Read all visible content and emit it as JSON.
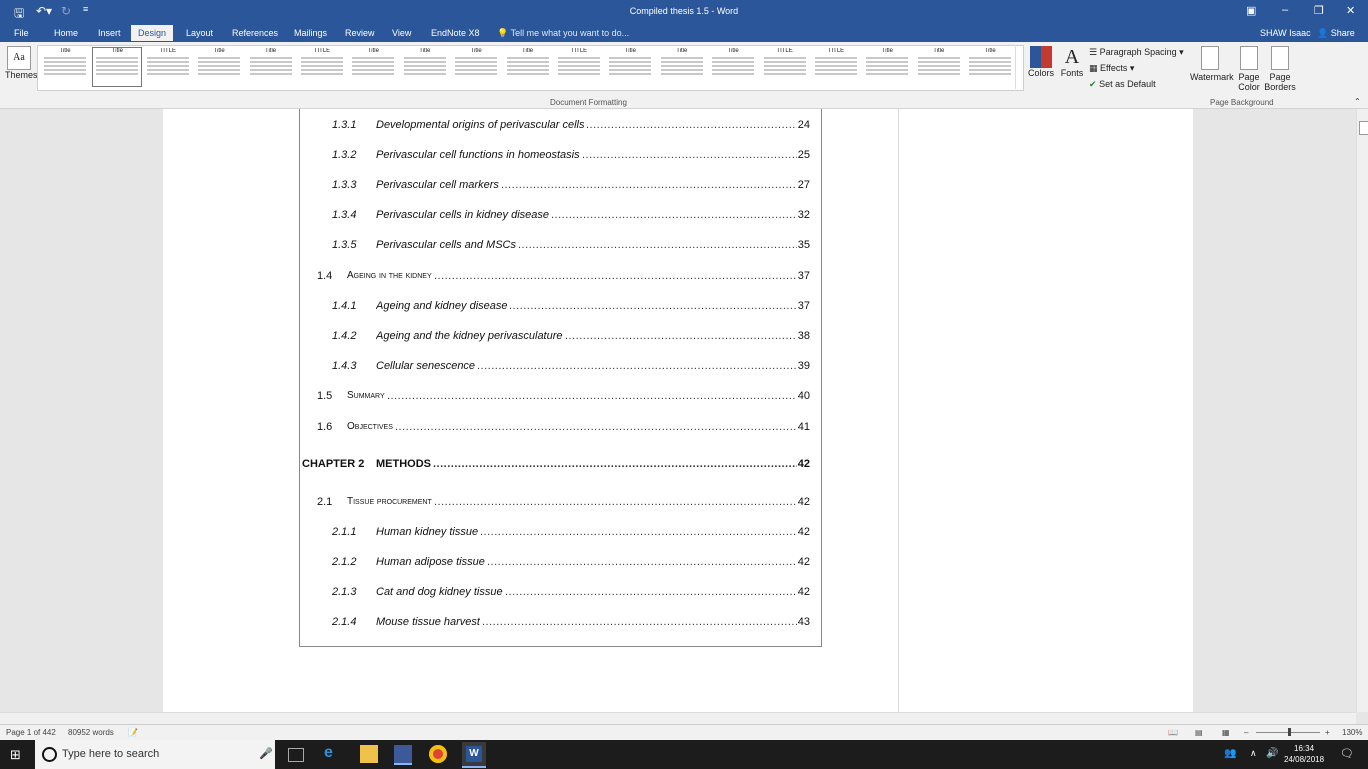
{
  "window": {
    "title": "Compiled thesis 1.5 - Word",
    "user": "SHAW Isaac",
    "share": "Share"
  },
  "tabs": [
    "File",
    "Home",
    "Insert",
    "Design",
    "Layout",
    "References",
    "Mailings",
    "Review",
    "View",
    "EndNote X8"
  ],
  "active_tab": "Design",
  "tell_me": "Tell me what you want to do...",
  "ribbon": {
    "themes": "Themes",
    "colors": "Colors",
    "fonts": "Fonts",
    "paragraph_spacing": "Paragraph Spacing",
    "effects": "Effects",
    "set_default": "Set as Default",
    "watermark": "Watermark",
    "page_color_1": "Page",
    "page_color_2": "Color",
    "page_borders_1": "Page",
    "page_borders_2": "Borders",
    "group_document_formatting": "Document Formatting",
    "group_page_background": "Page Background",
    "style_thumbs": [
      "Title",
      "Title",
      "TITLE",
      "Title",
      "Title",
      "TITLE",
      "Title",
      "Title",
      "Title",
      "Title",
      "TITLE",
      "Title",
      "Title",
      "Title",
      "TITLE",
      "TITLE",
      "Title",
      "Title",
      "Title"
    ]
  },
  "toc": [
    {
      "level": "sub",
      "num": "1.3.1",
      "title": "Developmental origins of perivascular cells",
      "page": "24"
    },
    {
      "level": "sub",
      "num": "1.3.2",
      "title": "Perivascular cell functions in homeostasis",
      "page": "25"
    },
    {
      "level": "sub",
      "num": "1.3.3",
      "title": "Perivascular cell markers",
      "page": "27"
    },
    {
      "level": "sub",
      "num": "1.3.4",
      "title": "Perivascular cells in kidney disease",
      "page": "32"
    },
    {
      "level": "sub",
      "num": "1.3.5",
      "title": "Perivascular cells and MSCs",
      "page": "35"
    },
    {
      "level": "sec",
      "num": "1.4",
      "title": "Ageing in the kidney",
      "page": "37"
    },
    {
      "level": "sub",
      "num": "1.4.1",
      "title": "Ageing and kidney disease",
      "page": "37"
    },
    {
      "level": "sub",
      "num": "1.4.2",
      "title": "Ageing and the kidney perivasculature",
      "page": "38"
    },
    {
      "level": "sub",
      "num": "1.4.3",
      "title": "Cellular senescence",
      "page": "39"
    },
    {
      "level": "sec",
      "num": "1.5",
      "title": "Summary",
      "page": "40"
    },
    {
      "level": "sec",
      "num": "1.6",
      "title": "Objectives",
      "page": "41"
    },
    {
      "level": "ch",
      "num": "CHAPTER 2",
      "title": "METHODS",
      "page": "42"
    },
    {
      "level": "sec",
      "num": "2.1",
      "title": "Tissue procurement",
      "page": "42"
    },
    {
      "level": "sub",
      "num": "2.1.1",
      "title": "Human kidney tissue",
      "page": "42"
    },
    {
      "level": "sub",
      "num": "2.1.2",
      "title": "Human adipose tissue",
      "page": "42"
    },
    {
      "level": "sub",
      "num": "2.1.3",
      "title": "Cat and dog kidney tissue",
      "page": "42"
    },
    {
      "level": "sub",
      "num": "2.1.4",
      "title": "Mouse tissue harvest",
      "page": "43"
    }
  ],
  "status": {
    "page": "Page 1 of 442",
    "words": "80952 words",
    "zoom": "130%"
  },
  "taskbar": {
    "search_placeholder": "Type here to search",
    "time": "16:34",
    "date": "24/08/2018"
  },
  "colors": {
    "accent": "#2b579a",
    "taskbar": "#1c1c1c"
  }
}
